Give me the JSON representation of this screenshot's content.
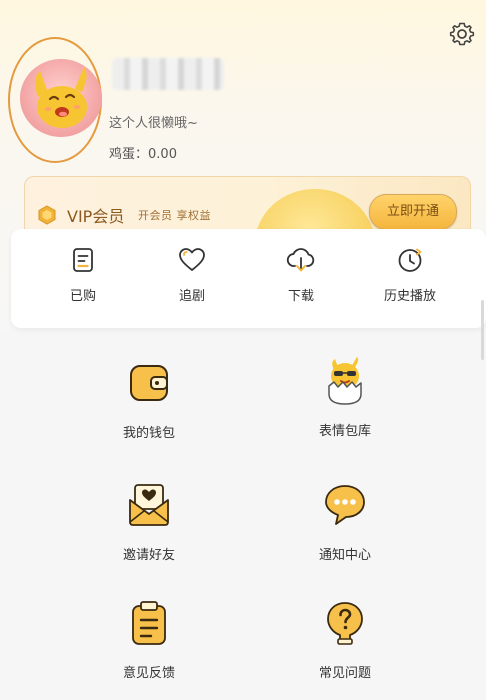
{
  "profile": {
    "bio": "这个人很懒哦~",
    "eggs_label": "鸡蛋：",
    "eggs_value": "0.00"
  },
  "vip": {
    "title": "VIP会员",
    "subtitle": "开会员 享权益",
    "button_label": "立即开通"
  },
  "quick_actions": [
    {
      "label": "已购",
      "icon": "purchased-icon"
    },
    {
      "label": "追剧",
      "icon": "heart-icon"
    },
    {
      "label": "下载",
      "icon": "download-icon"
    },
    {
      "label": "历史播放",
      "icon": "history-icon"
    }
  ],
  "menu": [
    {
      "label": "我的钱包",
      "icon": "wallet-icon"
    },
    {
      "label": "表情包库",
      "icon": "sticker-icon"
    },
    {
      "label": "邀请好友",
      "icon": "invite-envelope-icon"
    },
    {
      "label": "通知中心",
      "icon": "chat-bubble-icon"
    },
    {
      "label": "意见反馈",
      "icon": "clipboard-icon"
    },
    {
      "label": "常见问题",
      "icon": "question-icon"
    }
  ],
  "colors": {
    "accent": "#f4b53e",
    "avatar_ring": "#e49a3f",
    "vip_text": "#8a5a1f"
  }
}
